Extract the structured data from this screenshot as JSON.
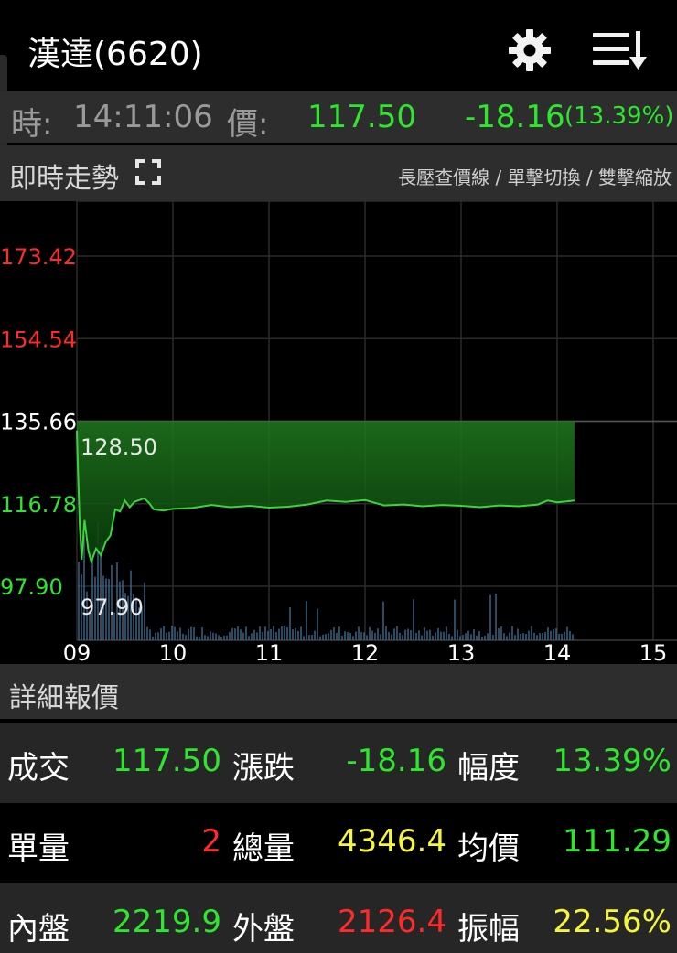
{
  "header": {
    "title": "漢達(6620)",
    "settings_icon": "gear-icon",
    "menu_icon": "sort-list-icon"
  },
  "quote": {
    "time_label": "時:",
    "time": "14:11:06",
    "price_label": "價:",
    "price": "117.50",
    "change": "-18.16",
    "change_pct": "(13.39%)",
    "color_up": "#2ee62e"
  },
  "intraday": {
    "title": "即時走勢",
    "expand_icon": "fullscreen-icon",
    "hint": "長壓查價線 / 單擊切換 / 雙擊縮放"
  },
  "chart_data": {
    "type": "area",
    "y_tick_labels": [
      "173.42",
      "154.54",
      "135.66",
      "116.78",
      "97.90"
    ],
    "y_ticks": [
      173.42,
      154.54,
      135.66,
      116.78,
      97.9
    ],
    "y_tick_colors": [
      "#ff2a2a",
      "#ff2a2a",
      "#ffffff",
      "#2ee62e",
      "#2ee62e"
    ],
    "ylim": [
      97.9,
      173.42
    ],
    "x_tick_labels": [
      "09",
      "10",
      "11",
      "12",
      "13",
      "14",
      "15"
    ],
    "xlim": [
      9,
      15
    ],
    "annotation_high": "128.50",
    "annotation_low": "97.90",
    "reference_price": 135.66,
    "price_series": [
      [
        9.0,
        133.5
      ],
      [
        9.01,
        126.0
      ],
      [
        9.03,
        112.0
      ],
      [
        9.05,
        104.0
      ],
      [
        9.08,
        113.0
      ],
      [
        9.12,
        106.0
      ],
      [
        9.15,
        103.5
      ],
      [
        9.2,
        106.5
      ],
      [
        9.25,
        105.0
      ],
      [
        9.3,
        108.0
      ],
      [
        9.35,
        109.5
      ],
      [
        9.4,
        115.5
      ],
      [
        9.45,
        115.0
      ],
      [
        9.5,
        117.5
      ],
      [
        9.55,
        116.0
      ],
      [
        9.6,
        117.2
      ],
      [
        9.7,
        118.0
      ],
      [
        9.75,
        117.0
      ],
      [
        9.8,
        115.5
      ],
      [
        9.9,
        115.2
      ],
      [
        10.0,
        115.6
      ],
      [
        10.2,
        115.8
      ],
      [
        10.4,
        116.5
      ],
      [
        10.6,
        116.0
      ],
      [
        10.8,
        116.3
      ],
      [
        11.0,
        115.9
      ],
      [
        11.2,
        116.1
      ],
      [
        11.4,
        116.6
      ],
      [
        11.6,
        117.5
      ],
      [
        11.8,
        117.2
      ],
      [
        12.0,
        117.6
      ],
      [
        12.1,
        117.0
      ],
      [
        12.2,
        116.4
      ],
      [
        12.4,
        116.6
      ],
      [
        12.6,
        116.2
      ],
      [
        12.8,
        116.5
      ],
      [
        13.0,
        116.3
      ],
      [
        13.2,
        116.0
      ],
      [
        13.4,
        116.4
      ],
      [
        13.6,
        116.2
      ],
      [
        13.8,
        116.6
      ],
      [
        13.9,
        117.5
      ],
      [
        14.0,
        117.1
      ],
      [
        14.1,
        117.3
      ],
      [
        14.18,
        117.5
      ]
    ],
    "line_color": "#3cd43c",
    "fill_color": "#1f7a1f"
  },
  "detail": {
    "title": "詳細報價",
    "rows": [
      [
        {
          "label": "成交",
          "value": "117.50",
          "color": "#2ee62e"
        },
        {
          "label": "漲跌",
          "value": "-18.16",
          "color": "#2ee62e"
        },
        {
          "label": "幅度",
          "value": "13.39%",
          "color": "#2ee62e"
        }
      ],
      [
        {
          "label": "單量",
          "value": "2",
          "color": "#ff2a2a"
        },
        {
          "label": "總量",
          "value": "4346.4",
          "color": "#f5f53a"
        },
        {
          "label": "均價",
          "value": "111.29",
          "color": "#2ee62e"
        }
      ],
      [
        {
          "label": "內盤",
          "value": "2219.9",
          "color": "#2ee62e"
        },
        {
          "label": "外盤",
          "value": "2126.4",
          "color": "#ff2a2a"
        },
        {
          "label": "振幅",
          "value": "22.56%",
          "color": "#f5f53a"
        }
      ]
    ]
  }
}
